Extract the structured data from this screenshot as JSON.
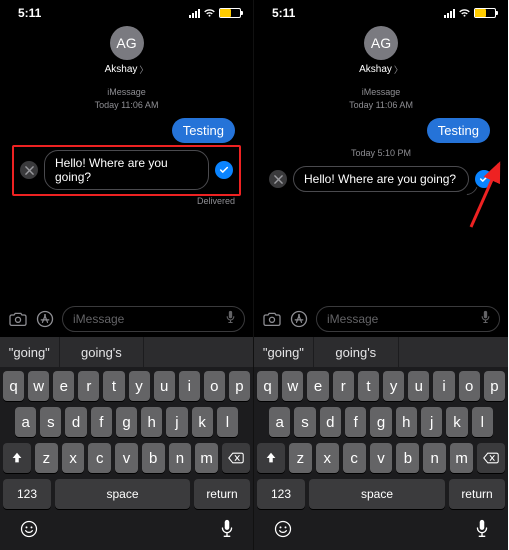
{
  "status": {
    "time": "5:11"
  },
  "contact": {
    "initials": "AG",
    "name": "Akshay"
  },
  "thread": {
    "service": "iMessage",
    "timestamp1": "Today 11:06 AM",
    "bubble_out": "Testing",
    "delivered": "Delivered",
    "timestamp2": "Today 5:10 PM",
    "edit_text": "Hello! Where are you going?"
  },
  "compose": {
    "placeholder": "iMessage"
  },
  "suggestions": {
    "s1": "\"going\"",
    "s2": "going's",
    "s3": ""
  },
  "keyboard": {
    "r1": [
      "q",
      "w",
      "e",
      "r",
      "t",
      "y",
      "u",
      "i",
      "o",
      "p"
    ],
    "r2": [
      "a",
      "s",
      "d",
      "f",
      "g",
      "h",
      "j",
      "k",
      "l"
    ],
    "r3": [
      "z",
      "x",
      "c",
      "v",
      "b",
      "n",
      "m"
    ],
    "n123": "123",
    "space": "space",
    "return": "return"
  }
}
